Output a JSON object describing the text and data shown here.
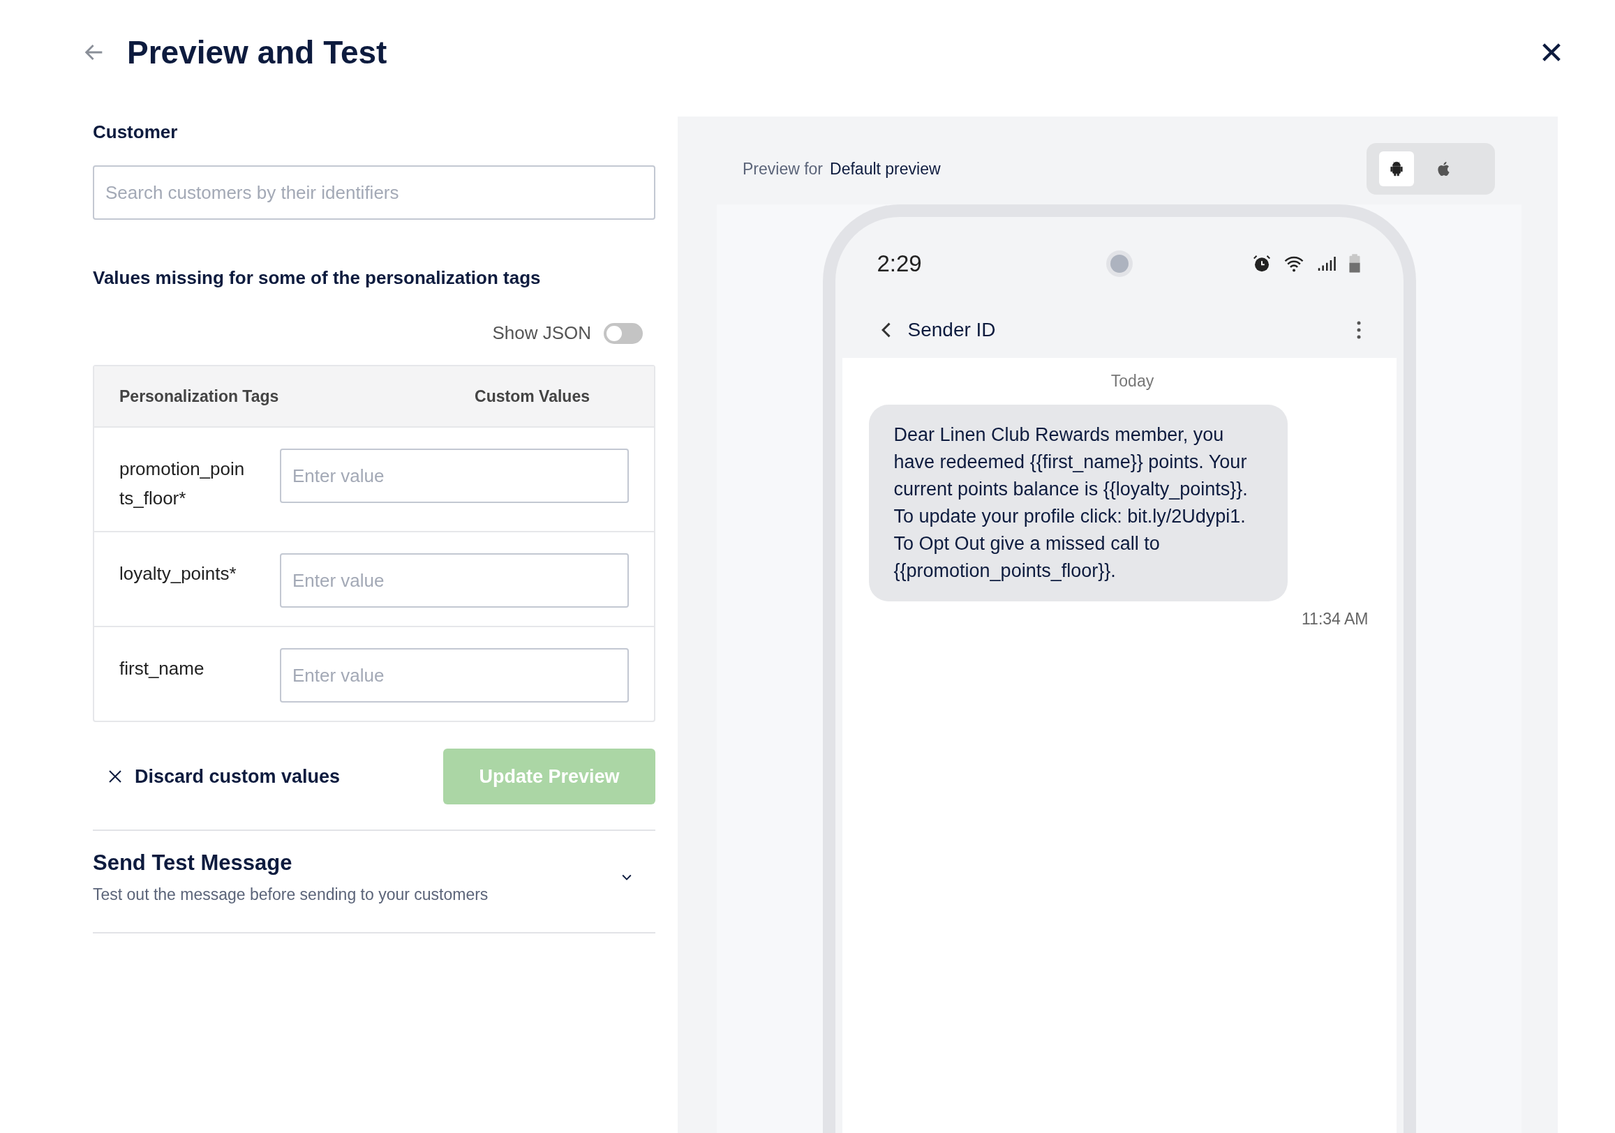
{
  "header": {
    "title": "Preview and Test"
  },
  "customer": {
    "label": "Customer",
    "placeholder": "Search customers by their identifiers"
  },
  "missing": {
    "heading": "Values missing for some of the personalization tags",
    "show_json": {
      "label": "Show JSON",
      "on": false
    }
  },
  "table": {
    "columns": [
      "Personalization Tags",
      "Custom Values"
    ],
    "rows": [
      {
        "tag": "promotion_points_floor*",
        "placeholder": "Enter value"
      },
      {
        "tag": "loyalty_points*",
        "placeholder": "Enter value"
      },
      {
        "tag": "first_name",
        "placeholder": "Enter value"
      }
    ]
  },
  "actions": {
    "discard": "Discard custom values",
    "update": {
      "label": "Update Preview",
      "disabled": true
    }
  },
  "send_test": {
    "title": "Send Test Message",
    "subtitle": "Test out the message before sending to your customers",
    "expanded": false
  },
  "preview": {
    "label": "Preview for",
    "value": "Default preview",
    "devices": [
      {
        "kind": "android",
        "selected": true
      },
      {
        "kind": "ios",
        "selected": false
      }
    ],
    "phone": {
      "time": "2:29",
      "sender": "Sender ID",
      "date": "Today",
      "message": "Dear Linen Club Rewards member, you have redeemed {{first_name}} points. Your current points balance is {{loyalty_points}}. To update your profile click: bit.ly/2Udypi1. To Opt Out give a missed call to {{promotion_points_floor}}.",
      "message_time": "11:34 AM"
    }
  }
}
